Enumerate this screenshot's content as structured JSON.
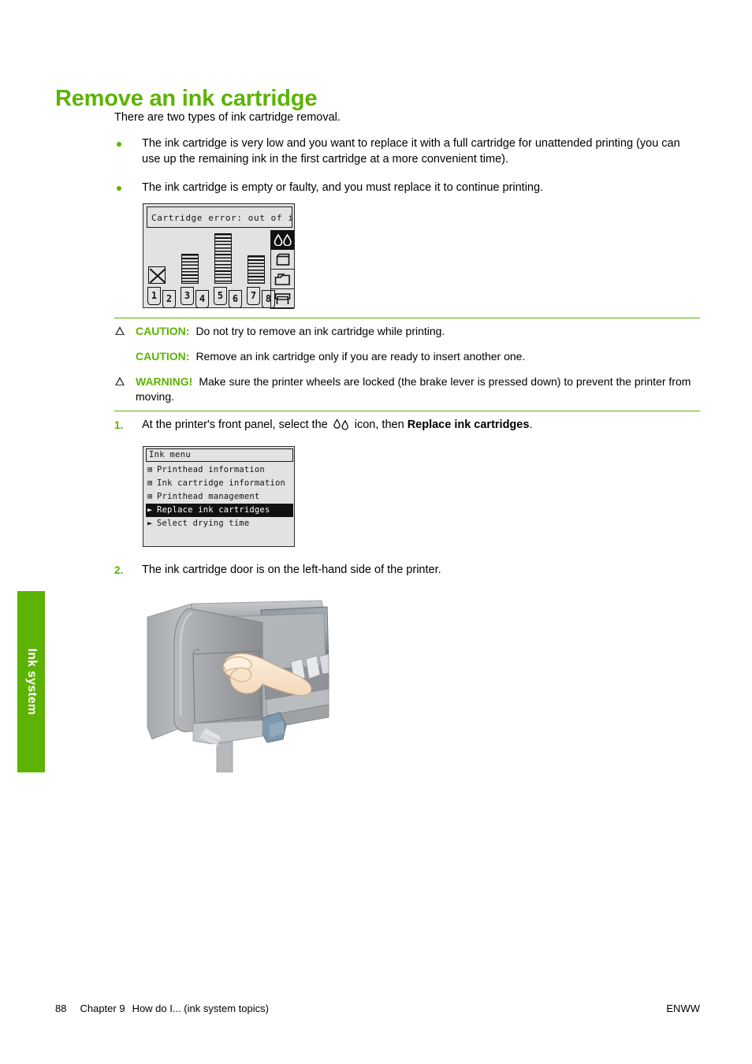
{
  "side_tab": {
    "label": "Ink system",
    "color": "#5cb300"
  },
  "page": {
    "title": "Remove an ink cartridge",
    "intro": "There are two types of ink cartridge removal.",
    "bullets": [
      "The ink cartridge is very low and you want to replace it with a full cartridge for unattended printing (you can use up the remaining ink in the first cartridge at a more convenient time).",
      "The ink cartridge is empty or faulty, and you must replace it to continue printing."
    ]
  },
  "lcd_error": {
    "status_message": "Cartridge error: out of ink",
    "side_icons": [
      {
        "name": "ink-drops-icon",
        "selected": true
      },
      {
        "name": "ink-tank-icon",
        "selected": false
      },
      {
        "name": "media-stack-icon",
        "selected": false
      },
      {
        "name": "printer-icon",
        "selected": false
      }
    ],
    "cartridges": [
      {
        "slot_a": "1",
        "slot_b": "2",
        "level": 0,
        "empty": true
      },
      {
        "slot_a": "3",
        "slot_b": "4",
        "level": 40,
        "empty": false
      },
      {
        "slot_a": "5",
        "slot_b": "6",
        "level": 68,
        "empty": false
      },
      {
        "slot_a": "7",
        "slot_b": "8",
        "level": 38,
        "empty": false
      }
    ]
  },
  "notes": [
    {
      "icon": "caution-triangle-icon",
      "show_icon": true,
      "keyword": "CAUTION:",
      "text": "Do not try to remove an ink cartridge while printing."
    },
    {
      "icon": "caution-triangle-icon",
      "show_icon": false,
      "keyword": "CAUTION:",
      "text": "Remove an ink cartridge only if you are ready to insert another one."
    },
    {
      "icon": "warning-triangle-icon",
      "show_icon": true,
      "keyword": "WARNING!",
      "text": "Make sure the printer wheels are locked (the brake lever is pressed down) to prevent the printer from moving."
    }
  ],
  "steps": [
    {
      "number": "1.",
      "text_before": "At the printer's front panel, select the",
      "icon": "ink-drops-icon",
      "text_middle": "icon, then",
      "bold": "Replace ink cartridges",
      "text_after": "."
    },
    {
      "number": "2.",
      "text": "The ink cartridge door is on the left-hand side of the printer."
    }
  ],
  "lcd_menu": {
    "title": "Ink menu",
    "items": [
      {
        "marker": "submenu",
        "label": "Printhead information",
        "selected": false
      },
      {
        "marker": "submenu",
        "label": "Ink cartridge information",
        "selected": false
      },
      {
        "marker": "submenu",
        "label": "Printhead management",
        "selected": false
      },
      {
        "marker": "action",
        "label": "Replace ink cartridges",
        "selected": true
      },
      {
        "marker": "action",
        "label": "Select drying time",
        "selected": false
      }
    ]
  },
  "illustration": {
    "name": "printer-ink-door-illustration"
  },
  "footer": {
    "page_number": "88",
    "chapter": "Chapter 9",
    "chapter_title": "How do I... (ink system topics)",
    "right": "ENWW"
  }
}
